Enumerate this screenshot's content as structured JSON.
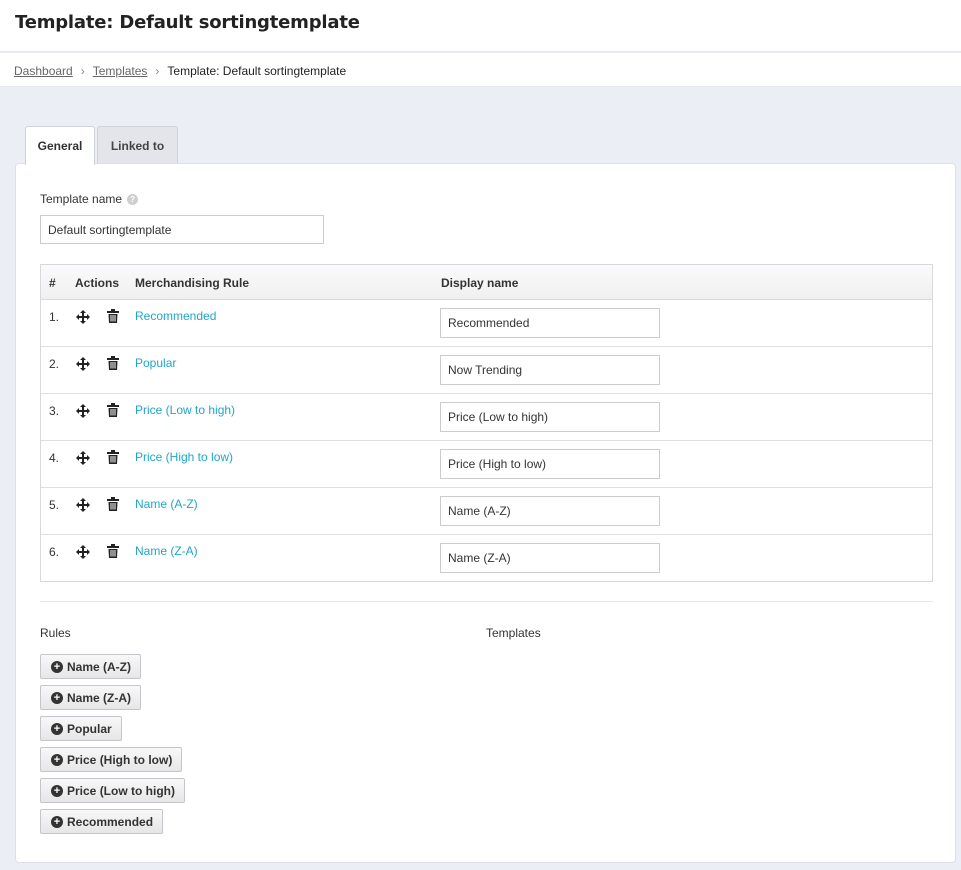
{
  "header": {
    "title": "Template: Default sortingtemplate"
  },
  "breadcrumb": {
    "items": [
      {
        "label": "Dashboard"
      },
      {
        "label": "Templates"
      }
    ],
    "separator": "›",
    "current": "Template: Default sortingtemplate"
  },
  "tabs": [
    {
      "label": "General",
      "active": true
    },
    {
      "label": "Linked to",
      "active": false
    }
  ],
  "form": {
    "template_name_label": "Template name",
    "help_icon": "?",
    "template_name_value": "Default sortingtemplate"
  },
  "table": {
    "columns": [
      "#",
      "Actions",
      "Merchandising Rule",
      "Display name"
    ],
    "rows": [
      {
        "num": "1.",
        "rule": "Recommended",
        "display": "Recommended"
      },
      {
        "num": "2.",
        "rule": "Popular",
        "display": "Now Trending"
      },
      {
        "num": "3.",
        "rule": "Price (Low to high)",
        "display": "Price (Low to high)"
      },
      {
        "num": "4.",
        "rule": "Price (High to low)",
        "display": "Price (High to low)"
      },
      {
        "num": "5.",
        "rule": "Name (A-Z)",
        "display": "Name (A-Z)"
      },
      {
        "num": "6.",
        "rule": "Name (Z-A)",
        "display": "Name (Z-A)"
      }
    ]
  },
  "sections": {
    "rules_heading": "Rules",
    "templates_heading": "Templates"
  },
  "available_rules": [
    {
      "label": "Name (A-Z)"
    },
    {
      "label": "Name (Z-A)"
    },
    {
      "label": "Popular"
    },
    {
      "label": "Price (High to low)"
    },
    {
      "label": "Price (Low to high)"
    },
    {
      "label": "Recommended"
    }
  ],
  "icons": {
    "move": "move-icon",
    "trash": "trash-icon",
    "plus": "plus-circle-icon",
    "help": "help-icon"
  },
  "colors": {
    "link": "#1fa7c7",
    "background": "#ebeef5"
  }
}
